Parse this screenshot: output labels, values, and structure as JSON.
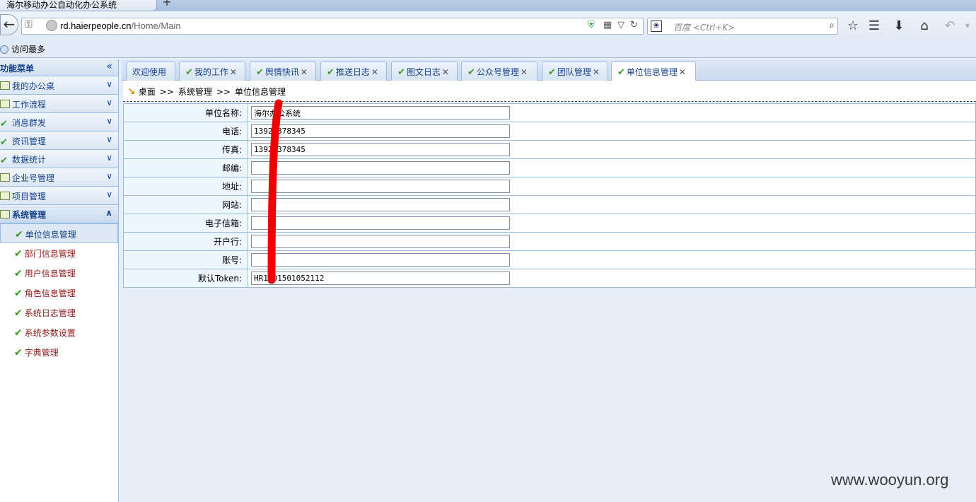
{
  "browser": {
    "tab_title": "海尔移动办公自动化办公系统",
    "new_tab": "+",
    "url_host": "rd.haierpeople.cn",
    "url_path": "/Home/Main",
    "search_placeholder": "百度 <Ctrl+K>",
    "search_engine_icon": "baidu-paw-icon",
    "bookmark": "访问最多"
  },
  "sidebar": {
    "title": "功能菜单",
    "items": [
      {
        "label": "我的办公桌",
        "icon": "doc"
      },
      {
        "label": "工作流程",
        "icon": "doc"
      },
      {
        "label": "消息群发",
        "icon": "chk"
      },
      {
        "label": "资讯管理",
        "icon": "chk"
      },
      {
        "label": "数据统计",
        "icon": "chk"
      },
      {
        "label": "企业号管理",
        "icon": "doc"
      },
      {
        "label": "项目管理",
        "icon": "doc"
      },
      {
        "label": "系统管理",
        "icon": "doc"
      }
    ],
    "subitems": [
      "单位信息管理",
      "部门信息管理",
      "用户信息管理",
      "角色信息管理",
      "系统日志管理",
      "系统参数设置",
      "字典管理"
    ]
  },
  "tabs": [
    "欢迎使用",
    "我的工作",
    "舆情快讯",
    "推送日志",
    "图文日志",
    "公众号管理",
    "团队管理",
    "单位信息管理"
  ],
  "breadcrumb": [
    "桌面",
    "系统管理",
    "单位信息管理"
  ],
  "breadcrumb_sep": ">>",
  "form": {
    "rows": [
      {
        "label": "单位名称:",
        "value": "海尔办公系统"
      },
      {
        "label": "电话:",
        "value": "13928378345"
      },
      {
        "label": "传真:",
        "value": "13928378345"
      },
      {
        "label": "邮编:",
        "value": ""
      },
      {
        "label": "地址:",
        "value": ""
      },
      {
        "label": "网站:",
        "value": ""
      },
      {
        "label": "电子信箱:",
        "value": ""
      },
      {
        "label": "开户行:",
        "value": ""
      },
      {
        "label": "账号:",
        "value": ""
      },
      {
        "label": "默认Token:",
        "value": "HR1001501052112"
      }
    ]
  },
  "watermark": "www.wooyun.org",
  "colors": {
    "accent": "#15428b",
    "border": "#99bbe8",
    "check": "#3a9a20",
    "redaction": "#ee0000"
  }
}
